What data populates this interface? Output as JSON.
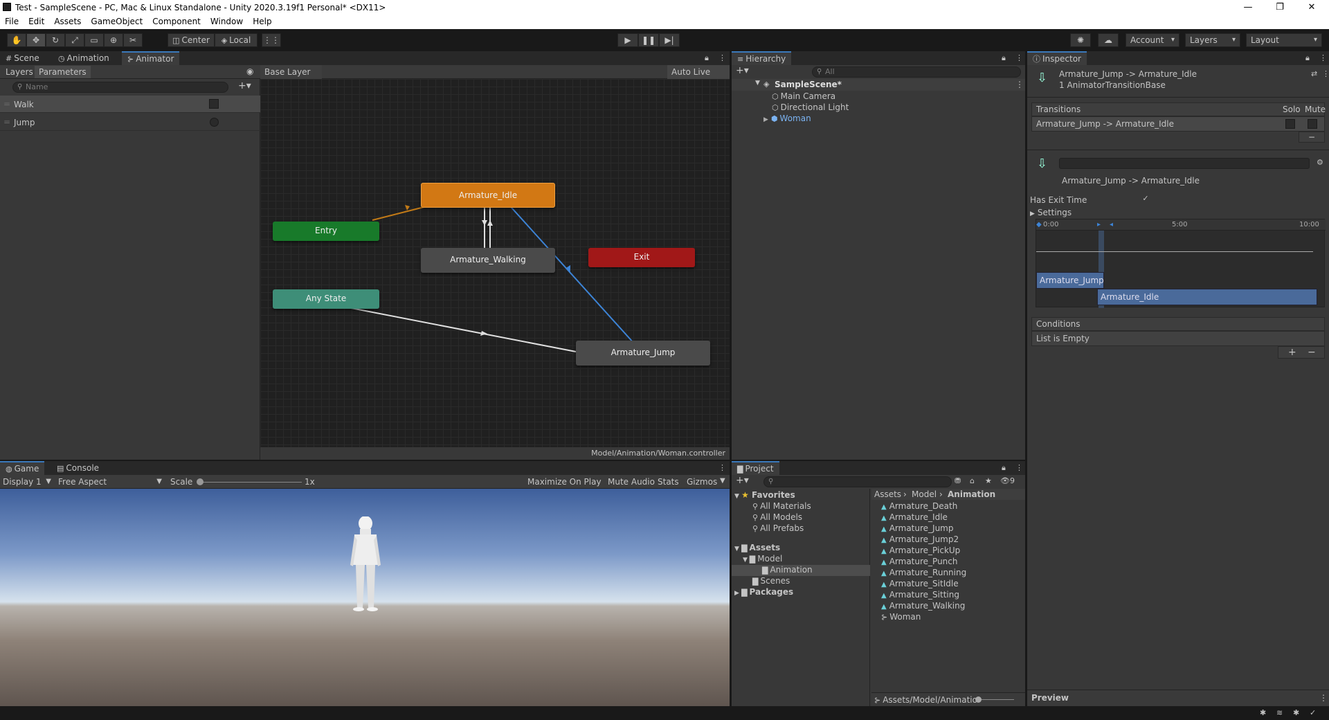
{
  "window": {
    "title": "Test - SampleScene - PC, Mac & Linux Standalone - Unity 2020.3.19f1 Personal* <DX11>",
    "min": "—",
    "max": "❐",
    "close": "✕"
  },
  "menu": [
    "File",
    "Edit",
    "Assets",
    "GameObject",
    "Component",
    "Window",
    "Help"
  ],
  "toolbar": {
    "pivot": "Center",
    "space": "Local",
    "account": "Account",
    "layers": "Layers",
    "layout": "Layout"
  },
  "scene_tabs": [
    "Scene",
    "Animation",
    "Animator"
  ],
  "animator": {
    "left_tabs": [
      "Layers",
      "Parameters"
    ],
    "name_placeholder": "Name",
    "params": [
      {
        "name": "Walk",
        "type": "bool"
      },
      {
        "name": "Jump",
        "type": "trigger"
      }
    ],
    "breadcrumb": "Base Layer",
    "auto_live_link": "Auto Live Link",
    "footer": "Model/Animation/Woman.controller",
    "nodes": {
      "idle": "Armature_Idle",
      "entry": "Entry",
      "walking": "Armature_Walking",
      "exit": "Exit",
      "any": "Any State",
      "jump": "Armature_Jump"
    },
    "colors": {
      "idle": "#d27814",
      "entry": "#187a2a",
      "exit": "#a11818",
      "any": "#3e8e78",
      "state": "#4a4a4a"
    }
  },
  "hierarchy": {
    "tab": "Hierarchy",
    "search_placeholder": "All",
    "scene": "SampleScene*",
    "items": [
      "Main Camera",
      "Directional Light",
      "Woman"
    ]
  },
  "inspector": {
    "tab": "Inspector",
    "title": "Armature_Jump -> Armature_Idle",
    "subtitle": "1 AnimatorTransitionBase",
    "transitions_label": "Transitions",
    "solo": "Solo",
    "mute": "Mute",
    "transition_row": "Armature_Jump -> Armature_Idle",
    "minus": "−",
    "transition_name": "Armature_Jump -> Armature_Idle",
    "has_exit_time": "Has Exit Time",
    "has_exit_time_value": "✓",
    "settings": "Settings",
    "timeline_ticks": [
      "0:00",
      "5:00",
      "10:00"
    ],
    "clip_a": "Armature_Jump",
    "clip_b": "Armature_Idle",
    "conditions": "Conditions",
    "list_empty": "List is Empty",
    "plus": "+",
    "preview": "Preview"
  },
  "game": {
    "tabs": [
      "Game",
      "Console"
    ],
    "display": "Display 1",
    "aspect": "Free Aspect",
    "scale_label": "Scale",
    "scale_value": "1x",
    "buttons": [
      "Maximize On Play",
      "Mute Audio",
      "Stats",
      "Gizmos"
    ]
  },
  "project": {
    "tab": "Project",
    "hidden_count": "9",
    "favorites": "Favorites",
    "fav_items": [
      "All Materials",
      "All Models",
      "All Prefabs"
    ],
    "assets": "Assets",
    "model": "Model",
    "animation": "Animation",
    "scenes": "Scenes",
    "packages": "Packages",
    "breadcrumb": [
      "Assets",
      "Model",
      "Animation"
    ],
    "files": [
      "Armature_Death",
      "Armature_Idle",
      "Armature_Jump",
      "Armature_Jump2",
      "Armature_PickUp",
      "Armature_Punch",
      "Armature_Running",
      "Armature_SitIdle",
      "Armature_Sitting",
      "Armature_Walking",
      "Woman"
    ],
    "footer_path": "Assets/Model/Animatio"
  }
}
